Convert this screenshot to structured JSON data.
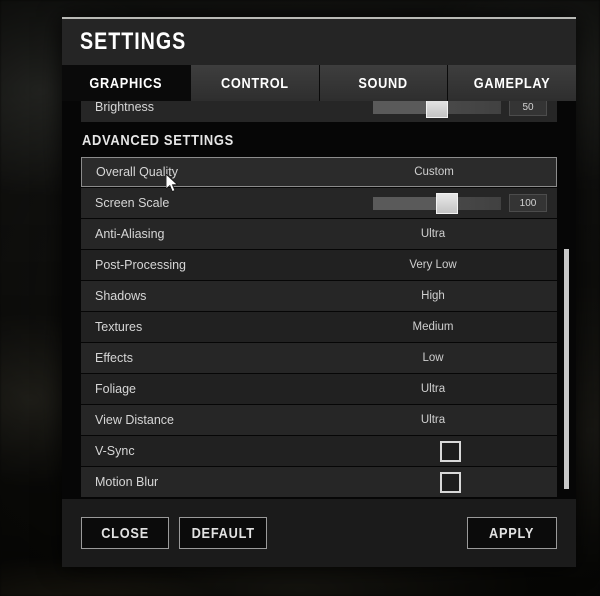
{
  "window": {
    "title": "SETTINGS"
  },
  "tabs": [
    {
      "label": "GRAPHICS",
      "active": true
    },
    {
      "label": "CONTROL",
      "active": false
    },
    {
      "label": "SOUND",
      "active": false
    },
    {
      "label": "GAMEPLAY",
      "active": false
    }
  ],
  "top_row": {
    "label": "Brightness",
    "type": "slider",
    "value": "50",
    "percent": 50
  },
  "section": {
    "heading": "ADVANCED SETTINGS"
  },
  "settings": [
    {
      "label": "Overall Quality",
      "type": "option",
      "value": "Custom",
      "highlight": true
    },
    {
      "label": "Screen Scale",
      "type": "slider",
      "value": "100",
      "percent": 58
    },
    {
      "label": "Anti-Aliasing",
      "type": "option",
      "value": "Ultra"
    },
    {
      "label": "Post-Processing",
      "type": "option",
      "value": "Very Low"
    },
    {
      "label": "Shadows",
      "type": "option",
      "value": "High"
    },
    {
      "label": "Textures",
      "type": "option",
      "value": "Medium"
    },
    {
      "label": "Effects",
      "type": "option",
      "value": "Low"
    },
    {
      "label": "Foliage",
      "type": "option",
      "value": "Ultra"
    },
    {
      "label": "View Distance",
      "type": "option",
      "value": "Ultra"
    },
    {
      "label": "V-Sync",
      "type": "checkbox",
      "checked": false
    },
    {
      "label": "Motion Blur",
      "type": "checkbox",
      "checked": false
    }
  ],
  "scrollbar": {
    "thumb_top_pct": 37,
    "thumb_height_pct": 60
  },
  "footer": {
    "close_label": "CLOSE",
    "default_label": "DEFAULT",
    "apply_label": "APPLY"
  },
  "colors": {
    "dialog_bg": "#060606",
    "row_bg": "#262626",
    "title_bar": "#252525",
    "accent_border": "#9a9a9a",
    "text": "#d6d6d6",
    "handle": "#e0e0e0"
  }
}
